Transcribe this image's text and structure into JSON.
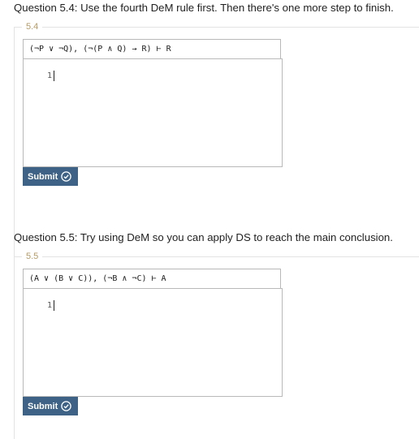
{
  "questions": [
    {
      "title": "Question 5.4: Use the fourth DeM rule first. Then there's one more step to finish.",
      "number": "5.4",
      "problem": "(¬P ∨ ¬Q), (¬(P ∧ Q) → R) ⊢ R",
      "line_number": "1",
      "submit_label": "Submit",
      "submit_icon": "check-circle-icon"
    },
    {
      "title": "Question 5.5: Try using DeM so you can apply DS to reach the main conclusion.",
      "number": "5.5",
      "problem": "(A ∨ (B ∨ C)), (¬B ∧ ¬C) ⊢ A",
      "line_number": "1",
      "submit_label": "Submit",
      "submit_icon": "check-circle-icon"
    }
  ],
  "colors": {
    "submit_bg": "#3d6285",
    "legend_text": "#b59a66",
    "border": "#b9b9b9"
  }
}
